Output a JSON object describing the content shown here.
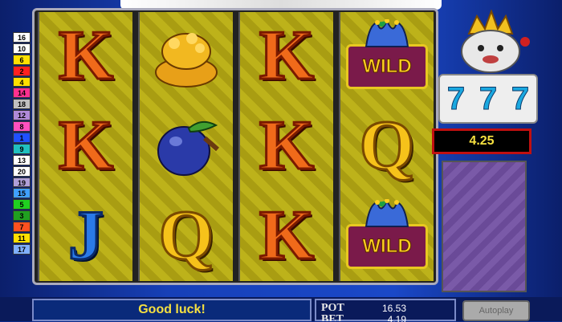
{
  "paylines": [
    {
      "label": "16",
      "color": "#ffffff"
    },
    {
      "label": "10",
      "color": "#ffffff"
    },
    {
      "label": "6",
      "color": "#ffe000"
    },
    {
      "label": "2",
      "color": "#ff2020"
    },
    {
      "label": "4",
      "color": "#ffe000"
    },
    {
      "label": "14",
      "color": "#ff3090"
    },
    {
      "label": "18",
      "color": "#c0c0c0"
    },
    {
      "label": "12",
      "color": "#b08ad8"
    },
    {
      "label": "8",
      "color": "#ff50c0"
    },
    {
      "label": "1",
      "color": "#2050ff"
    },
    {
      "label": "9",
      "color": "#20c0c0"
    },
    {
      "label": "13",
      "color": "#ffffff"
    },
    {
      "label": "20",
      "color": "#ffffff"
    },
    {
      "label": "19",
      "color": "#b0a0d8"
    },
    {
      "label": "15",
      "color": "#40a0ff"
    },
    {
      "label": "5",
      "color": "#20d020"
    },
    {
      "label": "3",
      "color": "#20a020"
    },
    {
      "label": "7",
      "color": "#ff5020"
    },
    {
      "label": "11",
      "color": "#ffe000"
    },
    {
      "label": "17",
      "color": "#80b0ff"
    }
  ],
  "reels": [
    [
      "K",
      "K",
      "J"
    ],
    [
      "gold-pot",
      "plum",
      "Q"
    ],
    [
      "K",
      "K",
      "K"
    ],
    [
      "WILD",
      "Q",
      "WILD"
    ]
  ],
  "wild_label": "WILD",
  "mini_reels": [
    "7",
    "7",
    "7"
  ],
  "win_amount": "4.25",
  "message": "Good luck!",
  "pot": {
    "label": "POT",
    "value": "16.53"
  },
  "bet": {
    "label": "BET",
    "value": "4.19"
  },
  "autoplay_label": "Autoplay"
}
